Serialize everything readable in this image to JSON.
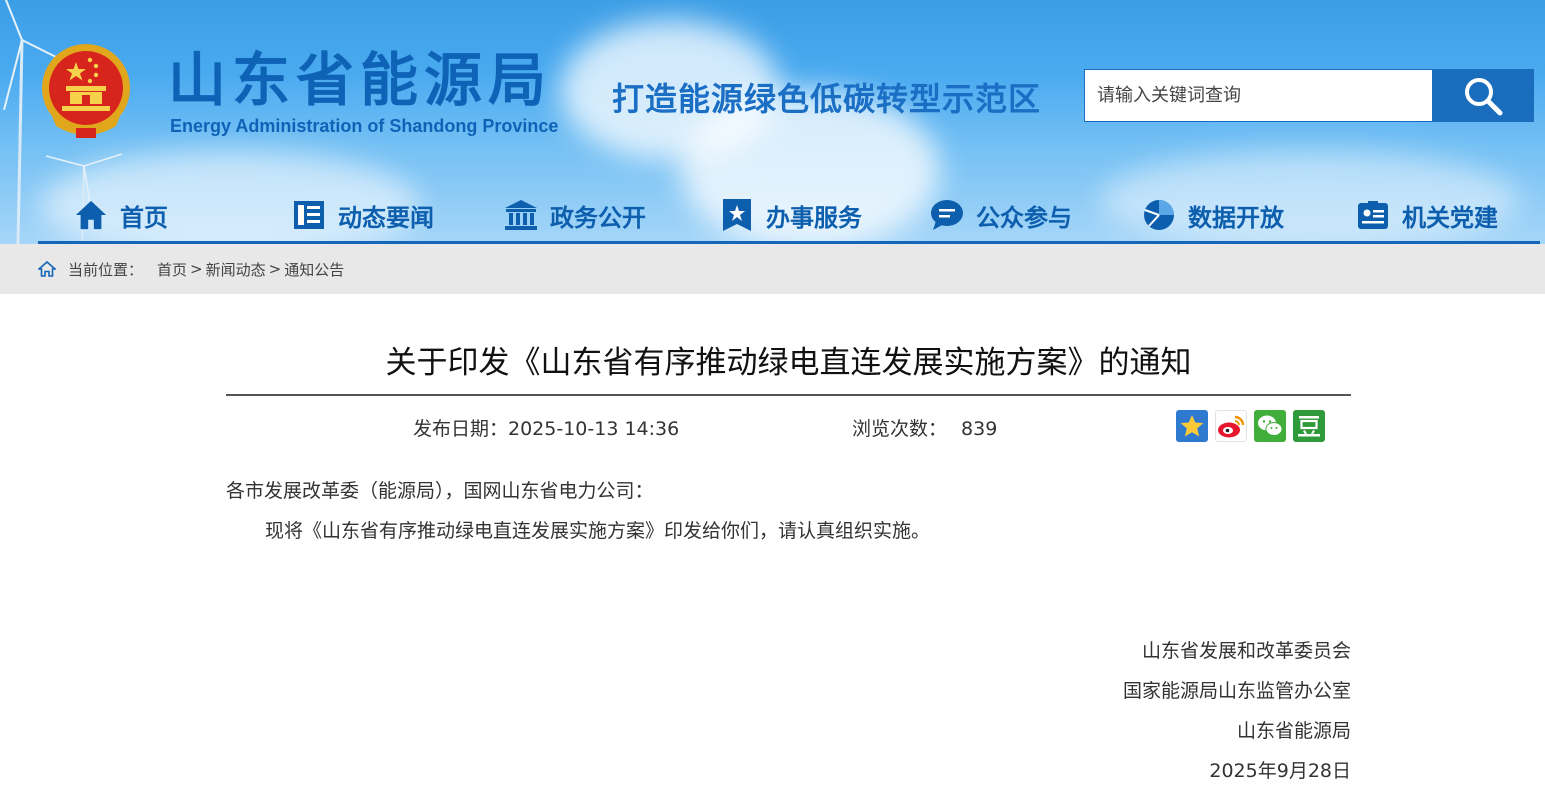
{
  "header": {
    "site_name_cn": "山东省能源局",
    "site_name_en": "Energy Administration of Shandong Province",
    "slogan": "打造能源绿色低碳转型示范区",
    "search_placeholder": "请输入关键词查询",
    "search_icon": "magnifier-icon"
  },
  "nav": {
    "items": [
      {
        "label": "首页",
        "icon": "house-icon"
      },
      {
        "label": "动态要闻",
        "icon": "newspaper-icon"
      },
      {
        "label": "政务公开",
        "icon": "government-building-icon"
      },
      {
        "label": "办事服务",
        "icon": "star-bookmark-icon"
      },
      {
        "label": "公众参与",
        "icon": "chat-bubble-icon"
      },
      {
        "label": "数据开放",
        "icon": "pie-chart-icon"
      },
      {
        "label": "机关党建",
        "icon": "id-card-icon"
      }
    ]
  },
  "breadcrumb": {
    "label": "当前位置：",
    "items": [
      "首页",
      "新闻动态",
      "通知公告"
    ],
    "separator": ">"
  },
  "article": {
    "title": "关于印发《山东省有序推动绿电直连发展实施方案》的通知",
    "date_label": "发布日期：2025-10-13 14:36",
    "views_label": "浏览次数：",
    "views_count": "839",
    "salutation": "各市发展改革委（能源局），国网山东省电力公司：",
    "body": "现将《山东省有序推动绿电直连发展实施方案》印发给你们，请认真组织实施。",
    "signatures": [
      "山东省发展和改革委员会",
      "国家能源局山东监管办公室",
      "山东省能源局",
      "2025年9月28日"
    ]
  },
  "share": {
    "buttons": [
      "qzone-star-icon",
      "weibo-icon",
      "wechat-icon",
      "douban-icon"
    ]
  },
  "colors": {
    "brand_blue": "#0e63b7",
    "nav_line": "#1565b8",
    "search_button": "#1a6dbd",
    "crumb_bg": "#e8e8e8"
  }
}
